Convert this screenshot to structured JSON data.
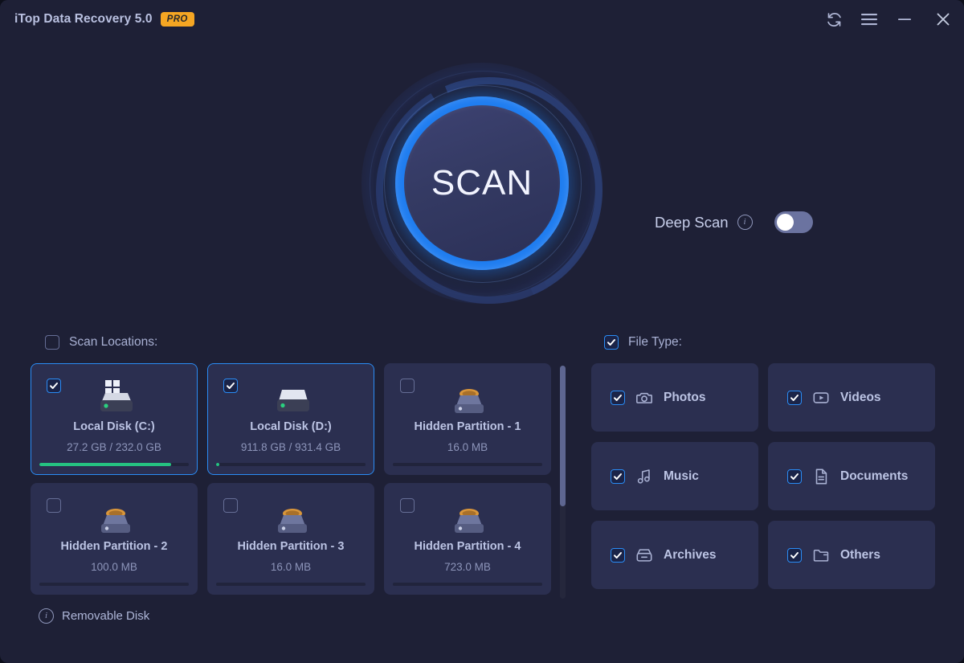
{
  "titlebar": {
    "app_title": "iTop Data Recovery 5.0",
    "pro_badge": "PRO",
    "buttons": [
      {
        "name": "refresh-icon",
        "tooltip": "Refresh"
      },
      {
        "name": "menu-icon",
        "tooltip": "Menu"
      },
      {
        "name": "minimize-icon",
        "tooltip": "Minimize"
      },
      {
        "name": "close-icon",
        "tooltip": "Close"
      }
    ]
  },
  "scan": {
    "button_label": "SCAN",
    "deep_scan_label": "Deep Scan",
    "deep_scan_enabled": false,
    "info_glyph": "i"
  },
  "locations": {
    "header_label": "Scan Locations:",
    "header_checked": false,
    "removable_label": "Removable Disk",
    "items": [
      {
        "name": "Local Disk (C:)",
        "size": "27.2 GB / 232.0 GB",
        "checked": true,
        "selected": true,
        "icon": "windows-drive-icon",
        "usage_percent": 88
      },
      {
        "name": "Local Disk (D:)",
        "size": "911.8 GB / 931.4 GB",
        "checked": true,
        "selected": true,
        "icon": "drive-icon",
        "usage_percent": 2
      },
      {
        "name": "Hidden Partition - 1",
        "size": "16.0 MB",
        "checked": false,
        "selected": false,
        "icon": "hidden-partition-icon",
        "usage_percent": 0
      },
      {
        "name": "Hidden Partition - 2",
        "size": "100.0 MB",
        "checked": false,
        "selected": false,
        "icon": "hidden-partition-icon",
        "usage_percent": 0
      },
      {
        "name": "Hidden Partition - 3",
        "size": "16.0 MB",
        "checked": false,
        "selected": false,
        "icon": "hidden-partition-icon",
        "usage_percent": 0
      },
      {
        "name": "Hidden Partition - 4",
        "size": "723.0 MB",
        "checked": false,
        "selected": false,
        "icon": "hidden-partition-icon",
        "usage_percent": 0
      }
    ]
  },
  "file_types": {
    "header_label": "File Type:",
    "header_checked": true,
    "items": [
      {
        "label": "Photos",
        "icon": "camera-icon",
        "checked": true
      },
      {
        "label": "Videos",
        "icon": "video-icon",
        "checked": true
      },
      {
        "label": "Music",
        "icon": "music-note-icon",
        "checked": true
      },
      {
        "label": "Documents",
        "icon": "document-icon",
        "checked": true
      },
      {
        "label": "Archives",
        "icon": "archive-box-icon",
        "checked": true
      },
      {
        "label": "Others",
        "icon": "folder-icon",
        "checked": true
      }
    ]
  },
  "colors": {
    "window_bg": "#1e2036",
    "card_bg": "#2b2f50",
    "accent_blue": "#2a8cf5",
    "scan_ring": "#1f7df0",
    "pro_badge": "#f5a623",
    "usage_green": "#25c281",
    "text_primary": "#bcc4e4",
    "text_secondary": "#8d95ba"
  }
}
